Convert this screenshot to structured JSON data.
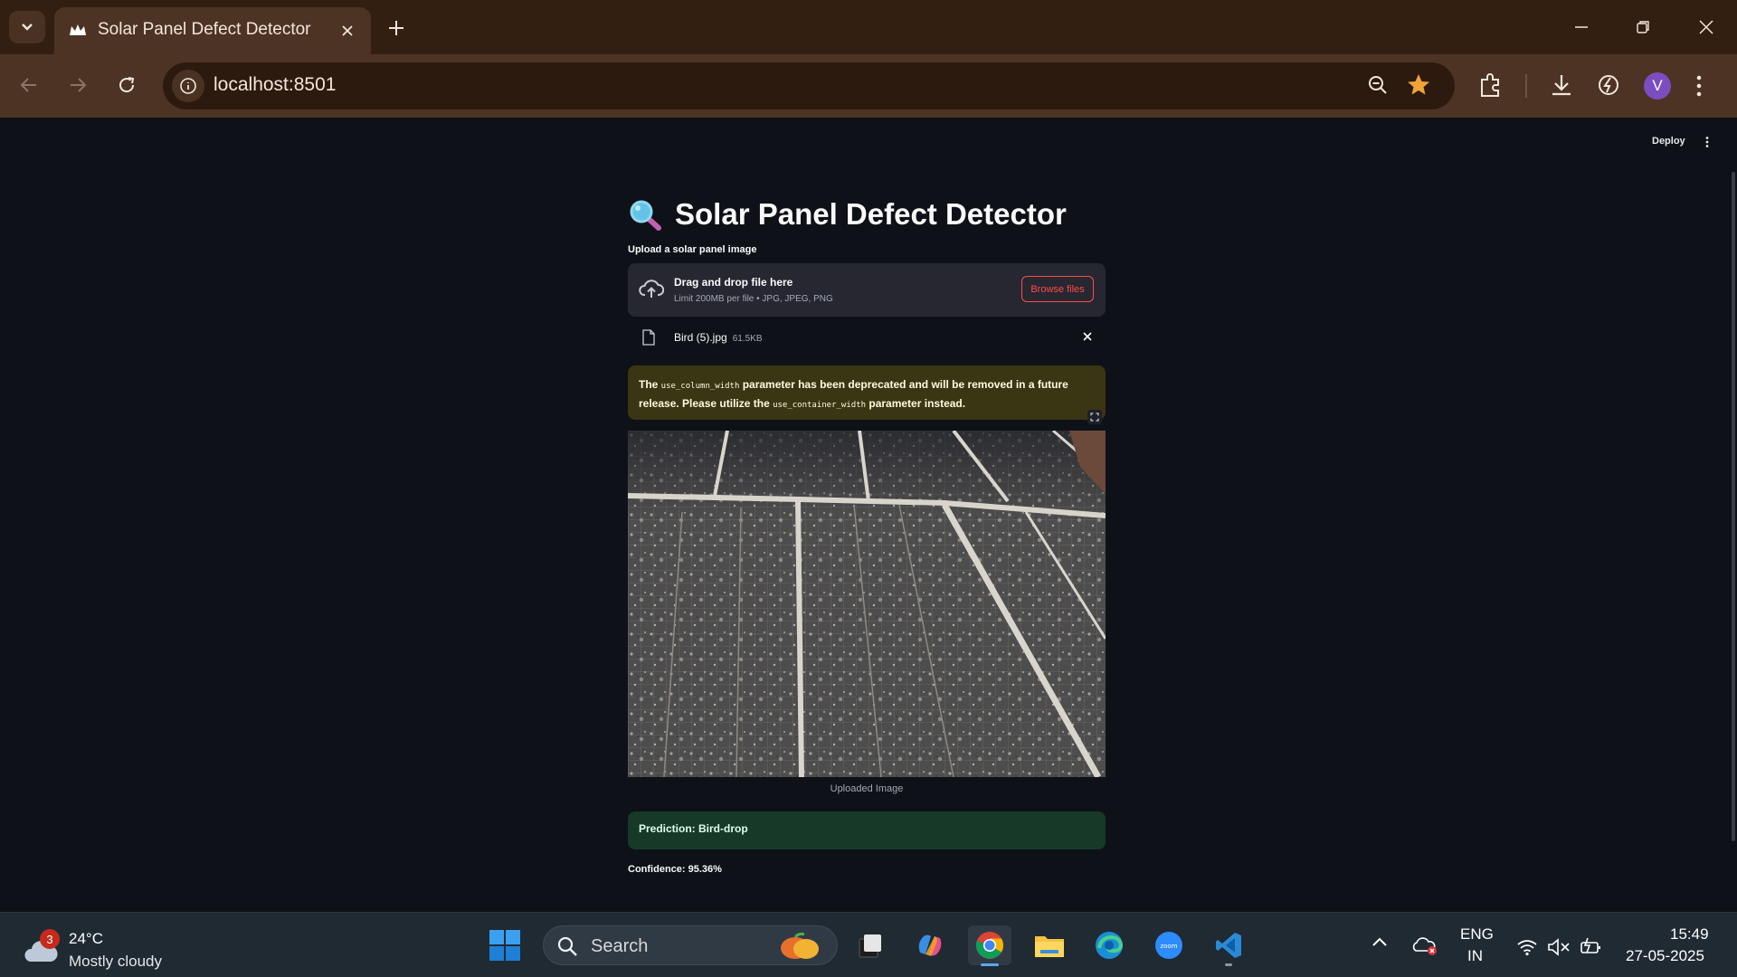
{
  "browser": {
    "tab_title": "Solar Panel Defect Detector",
    "url": "localhost:8501",
    "profile_initial": "V",
    "accent": "#d8762f"
  },
  "app": {
    "deploy_label": "Deploy",
    "title_emoji": "🔍",
    "title": "Solar Panel Defect Detector",
    "upload_label": "Upload a solar panel image",
    "dropzone_title": "Drag and drop file here",
    "dropzone_limit": "Limit 200MB per file • JPG, JPEG, PNG",
    "browse_label": "Browse files",
    "file_name": "Bird (5).jpg",
    "file_size": "61.5KB",
    "warning": {
      "part1": "The ",
      "code1": "use_column_width",
      "part2": " parameter has been deprecated and will be removed in a future release. Please utilize the ",
      "code2": "use_container_width",
      "part3": " parameter instead."
    },
    "image_caption": "Uploaded Image",
    "prediction_label": "Prediction: ",
    "prediction_value": "Bird-drop",
    "confidence_label": "Confidence: ",
    "confidence_value": "95.36%",
    "colors": {
      "primary": "#ff4b4b",
      "background": "#0e1117",
      "warning_bg": "#3a3513",
      "success_bg": "#173928"
    }
  },
  "taskbar": {
    "weather_badge": "3",
    "weather_temp": "24°C",
    "weather_desc": "Mostly cloudy",
    "search_label": "Search",
    "lang_line1": "ENG",
    "lang_line2": "IN",
    "time": "15:49",
    "date": "27-05-2025",
    "apps": [
      "file-manager",
      "copilot",
      "chrome",
      "file-explorer",
      "edge",
      "zoom",
      "vscode"
    ]
  }
}
